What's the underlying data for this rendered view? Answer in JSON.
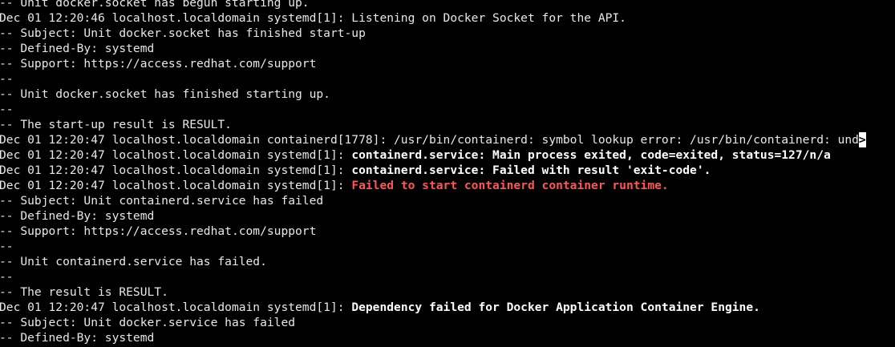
{
  "terminal": {
    "lines": [
      {
        "segments": [
          {
            "text": "-- Unit docker.socket has begun starting up.",
            "style": "normal"
          }
        ]
      },
      {
        "segments": [
          {
            "text": "Dec 01 12:20:46 localhost.localdomain systemd[1]: Listening on Docker Socket for the API.",
            "style": "normal"
          }
        ]
      },
      {
        "segments": [
          {
            "text": "-- Subject: Unit docker.socket has finished start-up",
            "style": "normal"
          }
        ]
      },
      {
        "segments": [
          {
            "text": "-- Defined-By: systemd",
            "style": "normal"
          }
        ]
      },
      {
        "segments": [
          {
            "text": "-- Support: https://access.redhat.com/support",
            "style": "normal"
          }
        ]
      },
      {
        "segments": [
          {
            "text": "--",
            "style": "normal"
          }
        ]
      },
      {
        "segments": [
          {
            "text": "-- Unit docker.socket has finished starting up.",
            "style": "normal"
          }
        ]
      },
      {
        "segments": [
          {
            "text": "--",
            "style": "normal"
          }
        ]
      },
      {
        "segments": [
          {
            "text": "-- The start-up result is RESULT.",
            "style": "normal"
          }
        ]
      },
      {
        "segments": [
          {
            "text": "Dec 01 12:20:47 localhost.localdomain containerd[1778]: /usr/bin/containerd: symbol lookup error: /usr/bin/containerd: und",
            "style": "normal"
          },
          {
            "text": ">",
            "style": "marker"
          }
        ]
      },
      {
        "segments": [
          {
            "text": "Dec 01 12:20:47 localhost.localdomain systemd[1]: ",
            "style": "normal"
          },
          {
            "text": "containerd.service: Main process exited, code=exited, status=127/n/a",
            "style": "bold"
          }
        ]
      },
      {
        "segments": [
          {
            "text": "Dec 01 12:20:47 localhost.localdomain systemd[1]: ",
            "style": "normal"
          },
          {
            "text": "containerd.service: Failed with result 'exit-code'.",
            "style": "bold"
          }
        ]
      },
      {
        "segments": [
          {
            "text": "Dec 01 12:20:47 localhost.localdomain systemd[1]: ",
            "style": "normal"
          },
          {
            "text": "Failed to start containerd container runtime.",
            "style": "red"
          }
        ]
      },
      {
        "segments": [
          {
            "text": "-- Subject: Unit containerd.service has failed",
            "style": "normal"
          }
        ]
      },
      {
        "segments": [
          {
            "text": "-- Defined-By: systemd",
            "style": "normal"
          }
        ]
      },
      {
        "segments": [
          {
            "text": "-- Support: https://access.redhat.com/support",
            "style": "normal"
          }
        ]
      },
      {
        "segments": [
          {
            "text": "--",
            "style": "normal"
          }
        ]
      },
      {
        "segments": [
          {
            "text": "-- Unit containerd.service has failed.",
            "style": "normal"
          }
        ]
      },
      {
        "segments": [
          {
            "text": "--",
            "style": "normal"
          }
        ]
      },
      {
        "segments": [
          {
            "text": "-- The result is RESULT.",
            "style": "normal"
          }
        ]
      },
      {
        "segments": [
          {
            "text": "Dec 01 12:20:47 localhost.localdomain systemd[1]: ",
            "style": "normal"
          },
          {
            "text": "Dependency failed for Docker Application Container Engine.",
            "style": "bold"
          }
        ]
      },
      {
        "segments": [
          {
            "text": "-- Subject: Unit docker.service has failed",
            "style": "normal"
          }
        ]
      },
      {
        "segments": [
          {
            "text": "-- Defined-By: systemd",
            "style": "normal"
          }
        ]
      }
    ]
  },
  "colors": {
    "background": "#000000",
    "foreground": "#e8e8e8",
    "bold": "#ffffff",
    "error": "#ff5555"
  }
}
